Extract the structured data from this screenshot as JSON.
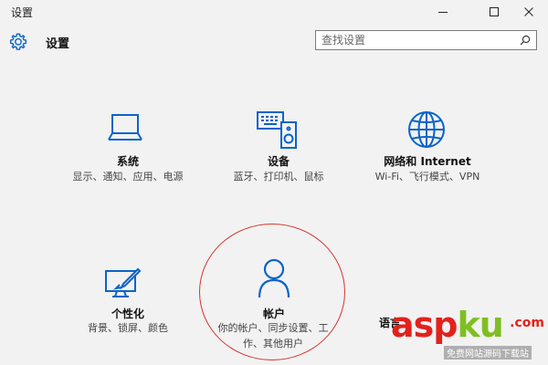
{
  "window": {
    "title": "设置",
    "minimize_icon": "minimize-icon",
    "maximize_icon": "maximize-icon",
    "close_icon": "close-icon"
  },
  "header": {
    "title": "设置",
    "icon": "gear-icon"
  },
  "search": {
    "placeholder": "查找设置",
    "icon": "search-icon"
  },
  "tiles": [
    {
      "title": "系统",
      "desc": "显示、通知、应用、电源",
      "icon": "laptop-icon"
    },
    {
      "title": "设备",
      "desc": "蓝牙、打印机、鼠标",
      "icon": "devices-icon"
    },
    {
      "title": "网络和 Internet",
      "desc": "Wi-Fi、飞行模式、VPN",
      "icon": "globe-icon"
    },
    {
      "title": "个性化",
      "desc": "背景、锁屏、颜色",
      "icon": "personalization-icon"
    },
    {
      "title": "帐户",
      "desc": "你的帐户、同步设置、工作、其他用户",
      "icon": "account-icon"
    },
    {
      "title": "语言",
      "desc": "",
      "icon": ""
    }
  ],
  "watermark": {
    "brand_a": "asp",
    "brand_b": "ku",
    "brand_c": ".com",
    "sub": "免费网站源码下载站"
  },
  "colors": {
    "accent": "#0a64c8",
    "annotation": "#d8322c"
  }
}
